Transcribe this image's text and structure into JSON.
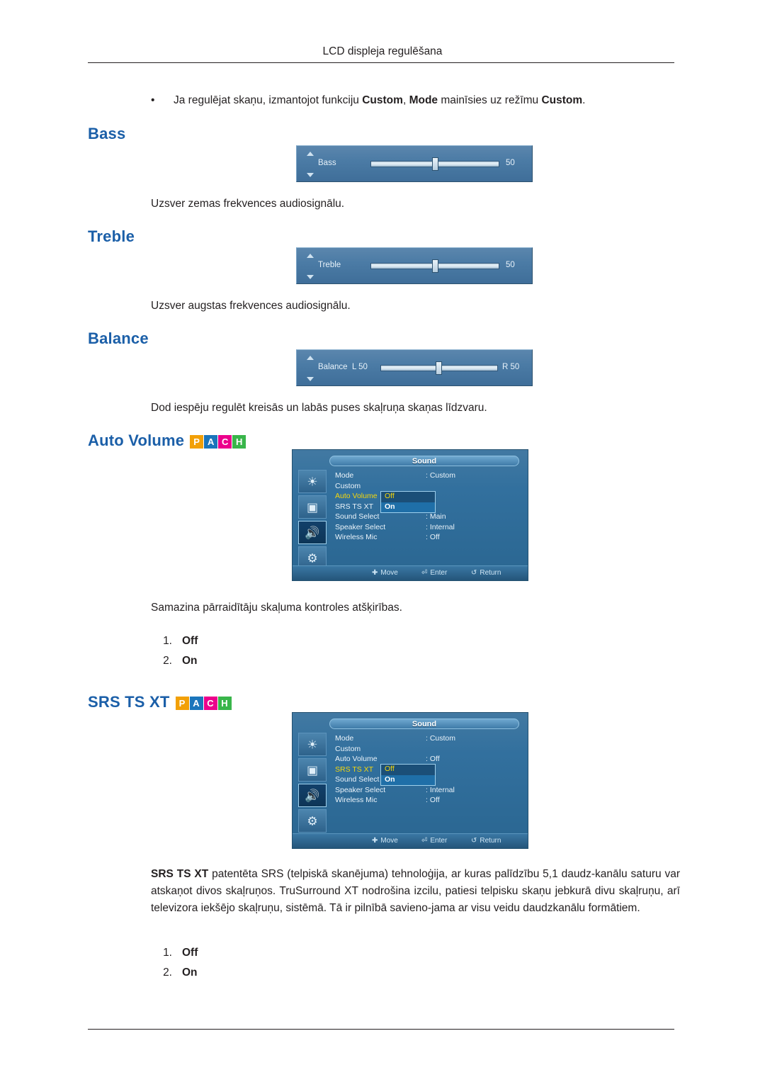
{
  "header": {
    "title": "LCD displeja regulēšana"
  },
  "bullet": {
    "dot": "•",
    "pre": "Ja regulējat skaņu, izmantojot funkciju ",
    "b1": "Custom",
    "mid1": ", ",
    "b2": "Mode",
    "mid2": " mainīsies uz režīmu ",
    "b3": "Custom",
    "post": "."
  },
  "sections": {
    "bass": {
      "title": "Bass",
      "desc": "Uzsver zemas frekvences audiosignālu.",
      "osd": {
        "label": "Bass",
        "value": "50"
      }
    },
    "treble": {
      "title": "Treble",
      "desc": "Uzsver augstas frekvences audiosignālu.",
      "osd": {
        "label": "Treble",
        "value": "50"
      }
    },
    "balance": {
      "title": "Balance",
      "desc": "Dod iespēju regulēt kreisās un labās puses skaļruņa skaņas līdzvaru.",
      "osd": {
        "label": "Balance",
        "left": "L  50",
        "right": "R  50"
      }
    },
    "auto_volume": {
      "title": "Auto Volume",
      "desc": "Samazina pārraidītāju skaļuma kontroles atšķirības.",
      "options": [
        {
          "idx": "1.",
          "value": "Off"
        },
        {
          "idx": "2.",
          "value": "On"
        }
      ]
    },
    "srs": {
      "title": "SRS TS XT",
      "paragraph": "SRS TS XT patentēta SRS (telpiskā skanējuma) tehnoloģija, ar kuras palīdzību 5,1 daudz-kanālu saturu var atskaņot divos skaļruņos. TruSurround XT nodrošina izcilu, patiesi telpisku skaņu jebkurā divu skaļruņu, arī televizora iekšējo skaļruņu, sistēmā. Tā ir pilnībā savieno-jama ar visu veidu daudzkanālu formātiem.",
      "para_bold": "SRS TS XT",
      "options": [
        {
          "idx": "1.",
          "value": "Off"
        },
        {
          "idx": "2.",
          "value": "On"
        }
      ]
    }
  },
  "pach": {
    "p": "P",
    "a": "A",
    "c": "C",
    "h": "H"
  },
  "osd_menu_1": {
    "title": "Sound",
    "rows": [
      {
        "name": "Mode",
        "value": ": Custom"
      },
      {
        "name": "Custom",
        "value": ""
      },
      {
        "name": "Auto Volume",
        "value": "",
        "highlight": true
      },
      {
        "name": "SRS TS XT",
        "value": ""
      },
      {
        "name": "Sound Select",
        "value": ": Main"
      },
      {
        "name": "Speaker Select",
        "value": ": Internal"
      },
      {
        "name": "Wireless Mic",
        "value": ": Off"
      }
    ],
    "select": {
      "opt_a": "Off",
      "opt_b": "On"
    },
    "footer": [
      {
        "icon": "✛",
        "label": "Move"
      },
      {
        "icon": "⏎",
        "label": "Enter"
      },
      {
        "icon": "↺",
        "label": "Return"
      }
    ],
    "icons": [
      "picture-icon",
      "screen-icon",
      "sound-icon",
      "setup-icon",
      "multi-control-icon"
    ]
  },
  "osd_menu_2": {
    "title": "Sound",
    "rows": [
      {
        "name": "Mode",
        "value": ": Custom"
      },
      {
        "name": "Custom",
        "value": ""
      },
      {
        "name": "Auto Volume",
        "value": ": Off"
      },
      {
        "name": "SRS TS XT",
        "value": "",
        "highlight": true
      },
      {
        "name": "Sound Select",
        "value": ""
      },
      {
        "name": "Speaker Select",
        "value": ": Internal"
      },
      {
        "name": "Wireless Mic",
        "value": ": Off"
      }
    ],
    "select": {
      "opt_a": "Off",
      "opt_b": "On"
    },
    "footer": [
      {
        "icon": "✛",
        "label": "Move"
      },
      {
        "icon": "⏎",
        "label": "Enter"
      },
      {
        "icon": "↺",
        "label": "Return"
      }
    ],
    "icons": [
      "picture-icon",
      "screen-icon",
      "sound-icon",
      "setup-icon",
      "multi-control-icon"
    ]
  }
}
